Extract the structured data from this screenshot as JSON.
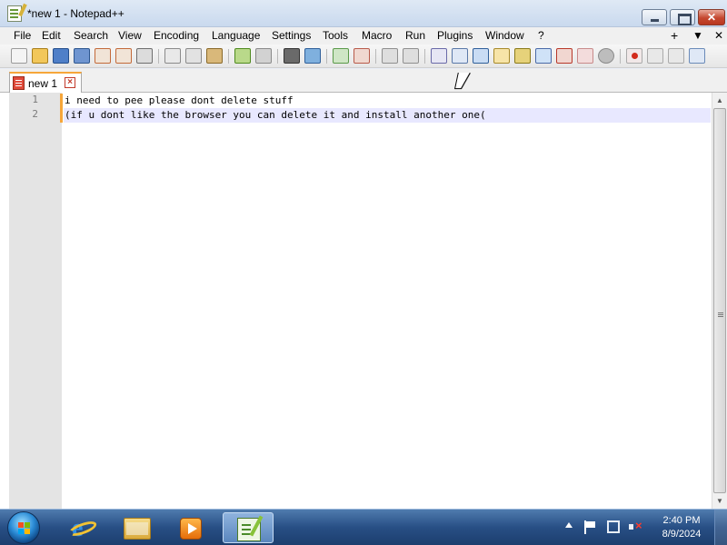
{
  "window": {
    "title": "*new 1 - Notepad++"
  },
  "menu": {
    "items": [
      "File",
      "Edit",
      "Search",
      "View",
      "Encoding",
      "Language",
      "Settings",
      "Tools",
      "Macro",
      "Run",
      "Plugins",
      "Window",
      "?"
    ],
    "right": [
      "+",
      "▼",
      "✕"
    ]
  },
  "tabs": [
    {
      "label": "new 1",
      "modified": true
    }
  ],
  "editor": {
    "line_numbers": [
      "1",
      "2"
    ],
    "lines": [
      "i need to pee please dont delete stuff",
      "(if u dont like the browser you can delete it and install another one("
    ],
    "current_line": 2
  },
  "taskbar": {
    "pinned": [
      "internet-explorer",
      "windows-explorer",
      "media-player",
      "notepad-plus-plus"
    ],
    "active": "notepad-plus-plus"
  },
  "clock": {
    "time": "2:40 PM",
    "date": "8/9/2024"
  }
}
